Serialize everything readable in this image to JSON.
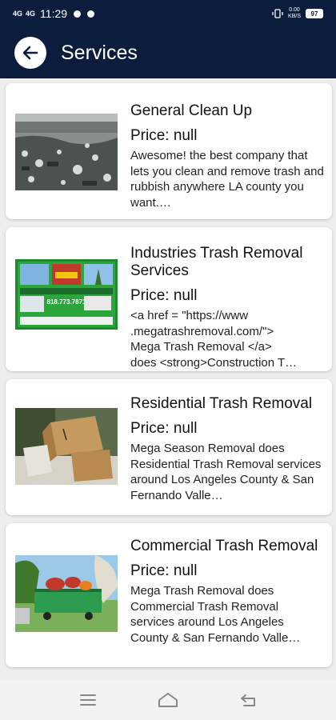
{
  "status_bar": {
    "signal_1": "4G",
    "signal_2": "4G",
    "time": "11:29",
    "speed": "0.00\nKB/S",
    "battery": "97"
  },
  "app_bar": {
    "title": "Services"
  },
  "services": [
    {
      "name": "General Clean Up",
      "price": "Price: null",
      "description": "Awesome! the best company that lets you clean and remove trash and rubbish anywhere LA county you want.…"
    },
    {
      "name": "Industries Trash Removal Services",
      "price": "Price: null",
      "description": "<a href = \"https://www\n.megatrashremoval.com/\">\nMega Trash Removal </a>\ndoes <strong>Construction T…",
      "image_text": "818.773.7871"
    },
    {
      "name": "Residential Trash Removal",
      "price": "Price: null",
      "description": "Mega Season Removal does Residential Trash Removal services around Los Angeles County & San Fernando Valle…"
    },
    {
      "name": "Commercial Trash Removal",
      "price": "Price: null",
      "description": "Mega Trash Removal does Commercial Trash Removal services around Los Angeles County & San Fernando Valle…"
    }
  ],
  "nav_bar": {
    "icons": [
      "menu-icon",
      "home-icon",
      "back-icon"
    ]
  }
}
